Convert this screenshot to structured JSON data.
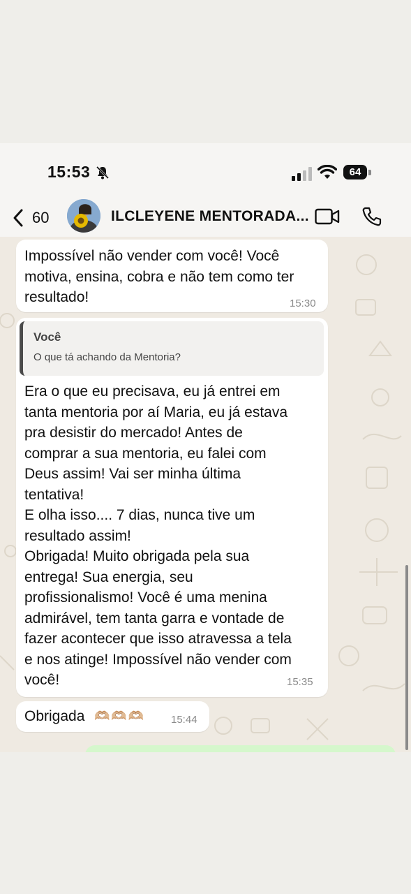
{
  "status_bar": {
    "time": "15:53",
    "battery": "64"
  },
  "header": {
    "back_count": "60",
    "contact_name": "ILCLEYENE MENTORADA..."
  },
  "messages": [
    {
      "text": "Impossível não vender com você! Você\nmotiva, ensina, cobra e não tem como ter\nresultado!",
      "time": "15:30"
    },
    {
      "quote_author": "Você",
      "quote_text": "O que tá achando da Mentoria?",
      "text": "Era o que eu precisava, eu já entrei em\ntanta mentoria por aí Maria, eu já estava\npra desistir do mercado! Antes de\ncomprar a sua mentoria, eu falei com\nDeus assim! Vai ser minha última\ntentativa!\nE olha isso.... 7 dias, nunca tive um\nresultado assim!\nObrigada! Muito obrigada pela sua\nentrega! Sua energia, seu\nprofissionalismo! Você é uma menina\nadmirável, tem tanta garra e vontade de\nfazer acontecer que isso atravessa a tela\ne nos atinge! Impossível não vender com\nvocê!",
      "time": "15:35"
    },
    {
      "text": "Obrigada",
      "emoji": "🫶🏼🫶🏼🫶🏼",
      "time": "15:44"
    }
  ],
  "colors": {
    "incoming_bubble": "#ffffff",
    "outgoing_bubble": "#d5f7cc",
    "chat_background": "#efeae2"
  },
  "icons": [
    "bell-slash-icon",
    "signal-icon",
    "wifi-icon",
    "battery-icon",
    "back-chevron-icon",
    "video-call-icon",
    "voice-call-icon"
  ]
}
